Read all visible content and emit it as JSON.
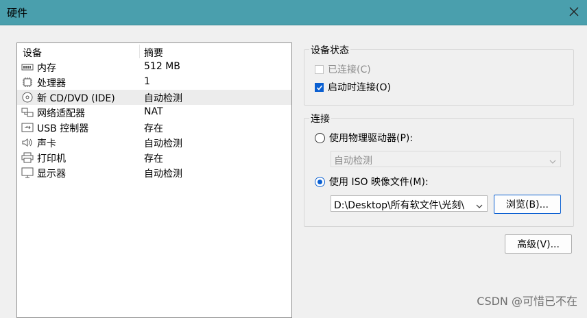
{
  "window": {
    "title": "硬件",
    "close_icon": "close-icon"
  },
  "device_list": {
    "headers": [
      "设备",
      "摘要"
    ],
    "rows": [
      {
        "icon": "memory-icon",
        "name": "内存",
        "summary": "512 MB"
      },
      {
        "icon": "processor-icon",
        "name": "处理器",
        "summary": "1"
      },
      {
        "icon": "cd-dvd-icon",
        "name": "新 CD/DVD (IDE)",
        "summary": "自动检测",
        "selected": true
      },
      {
        "icon": "network-adapter-icon",
        "name": "网络适配器",
        "summary": "NAT"
      },
      {
        "icon": "usb-icon",
        "name": "USB 控制器",
        "summary": "存在"
      },
      {
        "icon": "sound-icon",
        "name": "声卡",
        "summary": "自动检测"
      },
      {
        "icon": "printer-icon",
        "name": "打印机",
        "summary": "存在"
      },
      {
        "icon": "display-icon",
        "name": "显示器",
        "summary": "自动检测"
      }
    ]
  },
  "device_status": {
    "title": "设备状态",
    "connected_label": "已连接(C)",
    "connected_checked": false,
    "connected_disabled": true,
    "connect_on_start_label": "启动时连接(O)",
    "connect_on_start_checked": true
  },
  "connection": {
    "title": "连接",
    "physical_drive_label": "使用物理驱动器(P):",
    "physical_drive_selected": false,
    "physical_drive_value": "自动检测",
    "iso_label": "使用 ISO 映像文件(M):",
    "iso_selected": true,
    "iso_path": "D:\\Desktop\\所有软文件\\光刻\\",
    "browse_label": "浏览(B)..."
  },
  "advanced_label": "高级(V)...",
  "watermark": "CSDN @可惜已不在",
  "colors": {
    "titlebar": "#4a9fad",
    "accent": "#0a5fd1",
    "selected_row": "#ececec"
  }
}
